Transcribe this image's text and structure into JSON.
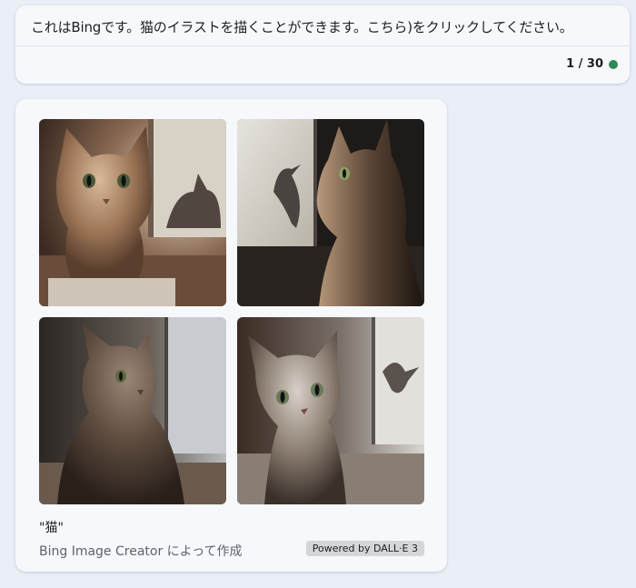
{
  "message": {
    "text": "これはBingです。猫のイラストを描くことができます。こちら)をクリックしてください。",
    "turn_counter": "1 / 30",
    "status_color": "#2e8b57"
  },
  "image_result": {
    "images": [
      {
        "subject": "cat by window, sunlit, facing viewer, shadow cat on window"
      },
      {
        "subject": "cat in profile looking out window, bird silhouette"
      },
      {
        "subject": "tabby cat sitting by window looking left"
      },
      {
        "subject": "cat facing viewer with bird shadow on window"
      }
    ],
    "prompt": "\"猫\"",
    "creator_text": "Bing Image Creator によって作成",
    "powered_by": "Powered by DALL·E 3"
  }
}
